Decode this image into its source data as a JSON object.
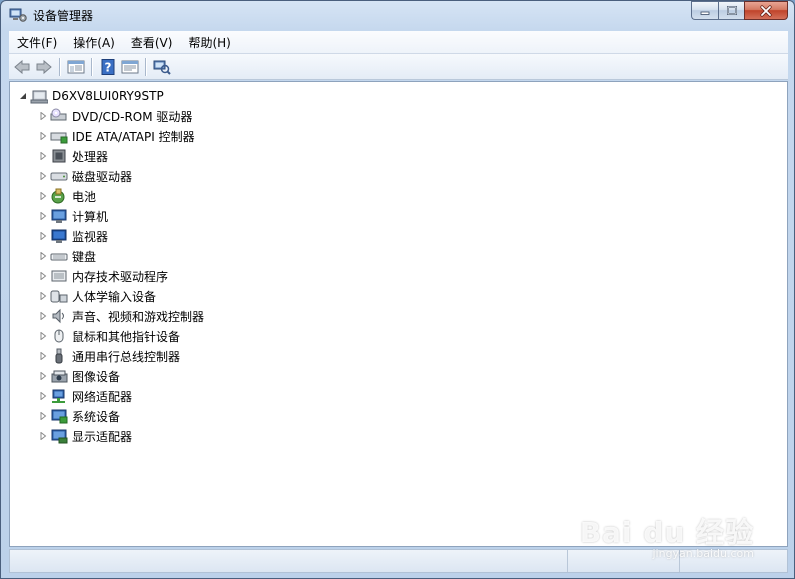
{
  "window": {
    "title": "设备管理器",
    "caption_buttons": [
      "minimize",
      "maximize",
      "close"
    ]
  },
  "menu": [
    {
      "label": "文件(F)"
    },
    {
      "label": "操作(A)"
    },
    {
      "label": "查看(V)"
    },
    {
      "label": "帮助(H)"
    }
  ],
  "toolbar": [
    {
      "icon": "back-arrow-icon"
    },
    {
      "icon": "forward-arrow-icon"
    },
    {
      "icon": "show-hide-console-tree-icon"
    },
    {
      "icon": "help-icon"
    },
    {
      "icon": "properties-icon"
    },
    {
      "icon": "scan-hardware-icon"
    }
  ],
  "tree": {
    "root": {
      "label": "D6XV8LUI0RY9STP",
      "icon": "computer-icon",
      "expanded": true
    },
    "items": [
      {
        "label": "DVD/CD-ROM 驱动器",
        "icon": "dvd-drive-icon"
      },
      {
        "label": "IDE ATA/ATAPI 控制器",
        "icon": "ide-controller-icon"
      },
      {
        "label": "处理器",
        "icon": "processor-icon"
      },
      {
        "label": "磁盘驱动器",
        "icon": "disk-drive-icon"
      },
      {
        "label": "电池",
        "icon": "battery-icon"
      },
      {
        "label": "计算机",
        "icon": "computer-monitor-icon"
      },
      {
        "label": "监视器",
        "icon": "monitor-icon"
      },
      {
        "label": "键盘",
        "icon": "keyboard-icon"
      },
      {
        "label": "内存技术驱动程序",
        "icon": "memory-icon"
      },
      {
        "label": "人体学输入设备",
        "icon": "hid-icon"
      },
      {
        "label": "声音、视频和游戏控制器",
        "icon": "speaker-icon"
      },
      {
        "label": "鼠标和其他指针设备",
        "icon": "mouse-icon"
      },
      {
        "label": "通用串行总线控制器",
        "icon": "usb-icon"
      },
      {
        "label": "图像设备",
        "icon": "imaging-device-icon"
      },
      {
        "label": "网络适配器",
        "icon": "network-adapter-icon"
      },
      {
        "label": "系统设备",
        "icon": "system-device-icon"
      },
      {
        "label": "显示适配器",
        "icon": "display-adapter-icon"
      }
    ]
  },
  "watermark": {
    "main": "Bai du 经验",
    "sub": "jingyan.baidu.com"
  }
}
